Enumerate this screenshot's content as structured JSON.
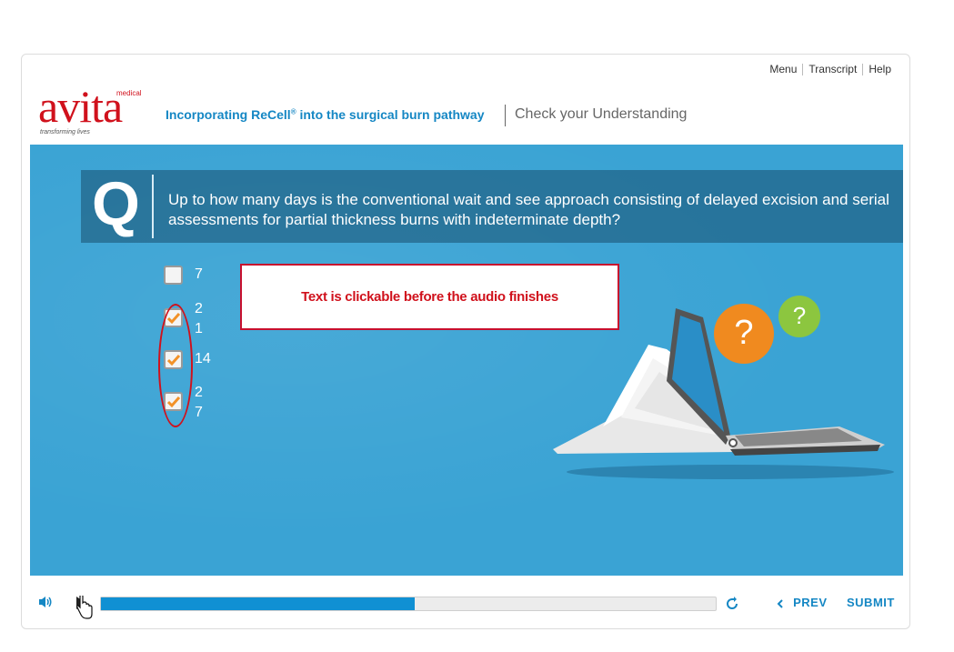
{
  "nav": {
    "menu": "Menu",
    "transcript": "Transcript",
    "help": "Help"
  },
  "logo": {
    "word": "avita",
    "medical": "medical",
    "tagline": "transforming lives"
  },
  "header": {
    "course_title_part1": "Incorporating ReCell",
    "course_title_reg": "®",
    "course_title_part2": " into the surgical burn pathway",
    "slide_title": "Check your Understanding"
  },
  "question": {
    "letter": "Q",
    "text": "Up to how many days is the conventional wait and see approach consisting of delayed excision and serial assessments for partial thickness burns with indeterminate depth?"
  },
  "options": [
    {
      "label": "7",
      "checked": false
    },
    {
      "label": "2\n1",
      "checked": true
    },
    {
      "label": "14",
      "checked": true
    },
    {
      "label": "2\n7",
      "checked": true
    }
  ],
  "annotation": {
    "text": "Text is clickable before the audio finishes"
  },
  "illustration": {
    "bubble_large": "?",
    "bubble_small": "?"
  },
  "controls": {
    "progress_percent": 51,
    "prev_label": "PREV",
    "submit_label": "SUBMIT",
    "prev_icon": "chevron-left-icon",
    "volume_icon": "volume-icon",
    "replay_icon": "replay-icon"
  },
  "colors": {
    "accent": "#1587c4",
    "stage": "#3aa3d4",
    "brand_red": "#d0111c",
    "check_orange": "#f29127"
  }
}
